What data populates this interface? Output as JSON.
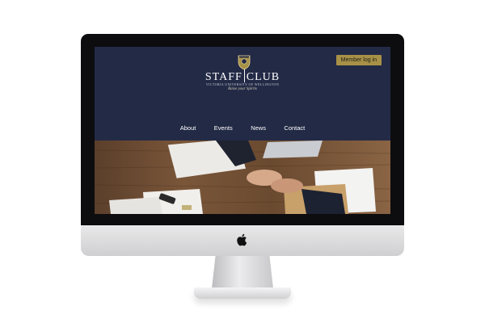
{
  "site": {
    "member_button": "Member log in",
    "logo_word_1": "STAFF",
    "logo_word_2": "CLUB",
    "logo_subtitle": "VICTORIA UNIVERSITY OF WELLINGTON",
    "tagline": "Raise your Spirits",
    "nav": [
      "About",
      "Events",
      "News",
      "Contact"
    ]
  },
  "icons": {
    "crest": "crest-icon",
    "apple": "apple-logo-icon"
  },
  "colors": {
    "header_bg": "#232a46",
    "accent_gold": "#a79146",
    "frame": "#0d0d0f"
  }
}
